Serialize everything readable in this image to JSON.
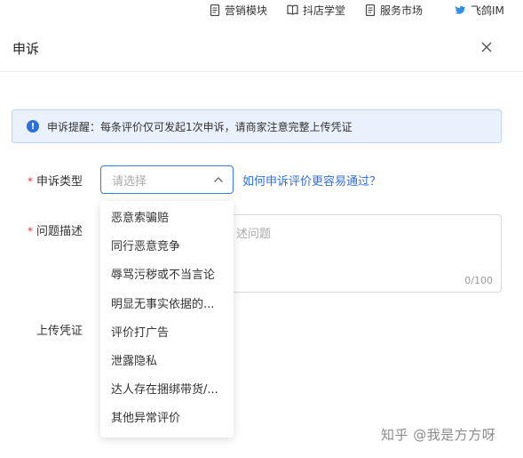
{
  "topnav": {
    "items": [
      {
        "label": "营销模块",
        "icon": "document-icon"
      },
      {
        "label": "抖店学堂",
        "icon": "book-icon"
      },
      {
        "label": "服务市场",
        "icon": "document-icon"
      },
      {
        "label": "飞鸽IM",
        "icon": "bird-icon"
      }
    ]
  },
  "modal": {
    "title": "申诉",
    "close_icon": "close-icon"
  },
  "alert": {
    "icon": "!",
    "text": "申诉提醒：每条评价仅可发起1次申诉，请商家注意完整上传凭证"
  },
  "form": {
    "type_label": "申诉类型",
    "type_placeholder": "请选择",
    "help_link": "如何申诉评价更容易通过？",
    "desc_label": "问题描述",
    "desc_placeholder": "述问题",
    "desc_count": "0/100",
    "upload_label": "上传凭证",
    "required_mark": "*"
  },
  "dropdown": {
    "options": [
      "恶意索骗赔",
      "同行恶意竞争",
      "辱骂污秽或不当言论",
      "明显无事实依据的...",
      "评价打广告",
      "泄露隐私",
      "达人存在捆绑带货/...",
      "其他异常评价"
    ]
  },
  "watermark": "知乎 @我是方方呀",
  "colors": {
    "accent": "#2f6fdb",
    "required": "#e3353a",
    "alert_bg": "#e9f1fc",
    "alert_border": "#bcd4f2"
  }
}
